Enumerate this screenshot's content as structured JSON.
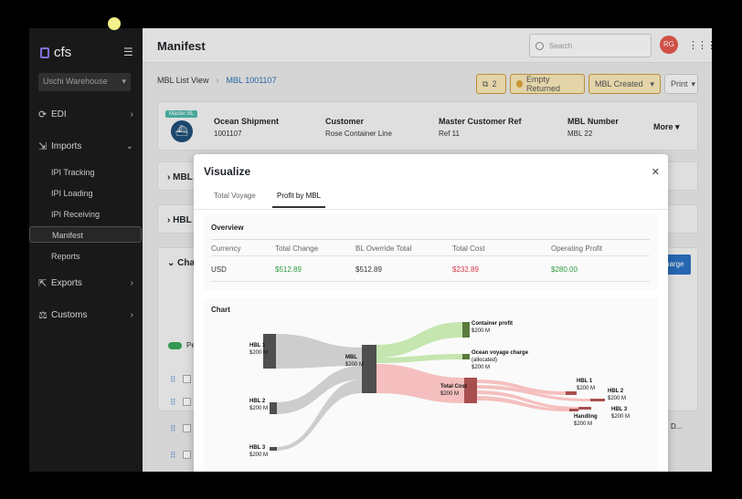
{
  "app": {
    "logo": "cfs",
    "warehouse": "Uschi Warehouse"
  },
  "sidebar": {
    "items": [
      {
        "label": "EDI",
        "icon": "refresh-icon"
      },
      {
        "label": "Imports",
        "icon": "import-icon"
      },
      {
        "label": "Exports",
        "icon": "export-icon"
      },
      {
        "label": "Customs",
        "icon": "customs-icon"
      }
    ],
    "imports_sub": [
      "IPI Tracking",
      "IPI Loading",
      "IPI Receiving",
      "Manifest",
      "Reports"
    ]
  },
  "header": {
    "title": "Manifest",
    "search_placeholder": "Search",
    "avatar": "RG"
  },
  "breadcrumb": {
    "parent": "MBL List View",
    "current": "MBL 1001107"
  },
  "actions": {
    "copy_count": "2",
    "status_returned": "Empty Returned",
    "status_created": "MBL Created",
    "print": "Print"
  },
  "mbl": {
    "badge": "Master BL",
    "fields": [
      {
        "label": "Ocean Shipment",
        "value": "1001107"
      },
      {
        "label": "Customer",
        "value": "Rose Container Line"
      },
      {
        "label": "Master Customer Ref",
        "value": "Ref 11"
      },
      {
        "label": "MBL Number",
        "value": "MBL 22"
      }
    ],
    "more": "More"
  },
  "sections": {
    "mbl": "MBL",
    "hbl": "HBL",
    "charges": "Char",
    "charge_button": "harge",
    "toggle_label": "Pe",
    "row_tail": "D..."
  },
  "modal": {
    "title": "Visualize",
    "tabs": [
      "Total Voyage",
      "Profit by MBL"
    ],
    "active_tab": "Profit by MBL",
    "overview": {
      "title": "Overview",
      "headers": [
        "Currency",
        "Total Change",
        "BL Override Total",
        "Total Cost",
        "Operating Profit"
      ],
      "row": [
        "USD",
        "$512.89",
        "$512.89",
        "$232.89",
        "$280.00"
      ]
    },
    "chart_title": "Chart"
  },
  "chart_data": {
    "type": "sankey",
    "nodes": [
      {
        "name": "HBL 1",
        "value_label": "$200 M"
      },
      {
        "name": "HBL 2",
        "value_label": "$200 M"
      },
      {
        "name": "HBL 3",
        "value_label": "$200 M"
      },
      {
        "name": "MBL",
        "value_label": "$200 M"
      },
      {
        "name": "Container profit",
        "value_label": "$200 M"
      },
      {
        "name": "Ocean voyage charge",
        "sub": "(allocated)",
        "value_label": "$200 M"
      },
      {
        "name": "Total Cost",
        "value_label": "$200 M"
      },
      {
        "name": "HBL 1",
        "value_label": "$200 M"
      },
      {
        "name": "HBL 2",
        "value_label": "$200 M"
      },
      {
        "name": "HBL 3",
        "value_label": "$200 M"
      },
      {
        "name": "Handling",
        "value_label": "$200 M"
      }
    ],
    "colors": {
      "source": "#4f4f4f",
      "flow_gray": "#c8c8c8",
      "profit": "#bfe3a6",
      "profit_node": "#5b7a3c",
      "cost": "#f4b8b8",
      "cost_node": "#a84f4f"
    }
  }
}
